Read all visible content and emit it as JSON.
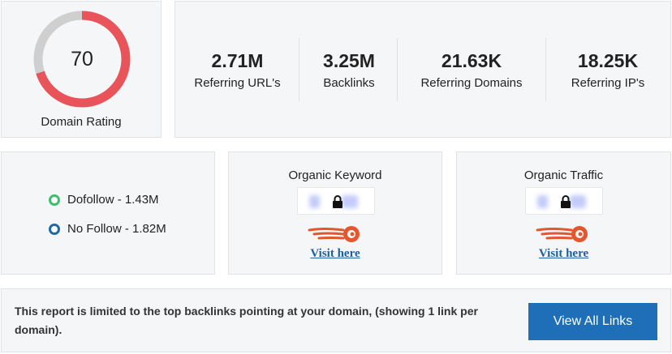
{
  "domain_rating": {
    "value": "70",
    "label": "Domain Rating",
    "progress": 0.7,
    "track_color": "#cfcfcf",
    "fill_color": "#e8545a"
  },
  "stats": [
    {
      "value": "2.71M",
      "label": "Referring URL's"
    },
    {
      "value": "3.25M",
      "label": "Backlinks"
    },
    {
      "value": "21.63K",
      "label": "Referring Domains"
    },
    {
      "value": "18.25K",
      "label": "Referring IP's"
    }
  ],
  "follow": {
    "dofollow": {
      "label": "Dofollow - 1.43M",
      "color": "#3fbf6e"
    },
    "nofollow": {
      "label": "No Follow - 1.82M",
      "color": "#1f6aa5"
    }
  },
  "organic_keyword": {
    "title": "Organic Keyword",
    "link": "Visit here",
    "icon": "lock-icon"
  },
  "organic_traffic": {
    "title": "Organic Traffic",
    "link": "Visit here",
    "icon": "lock-icon"
  },
  "report": {
    "text": "This report is limited to the top backlinks pointing at your domain, (showing 1 link per domain).",
    "button": "View All Links",
    "button_color": "#1e6fb8"
  }
}
